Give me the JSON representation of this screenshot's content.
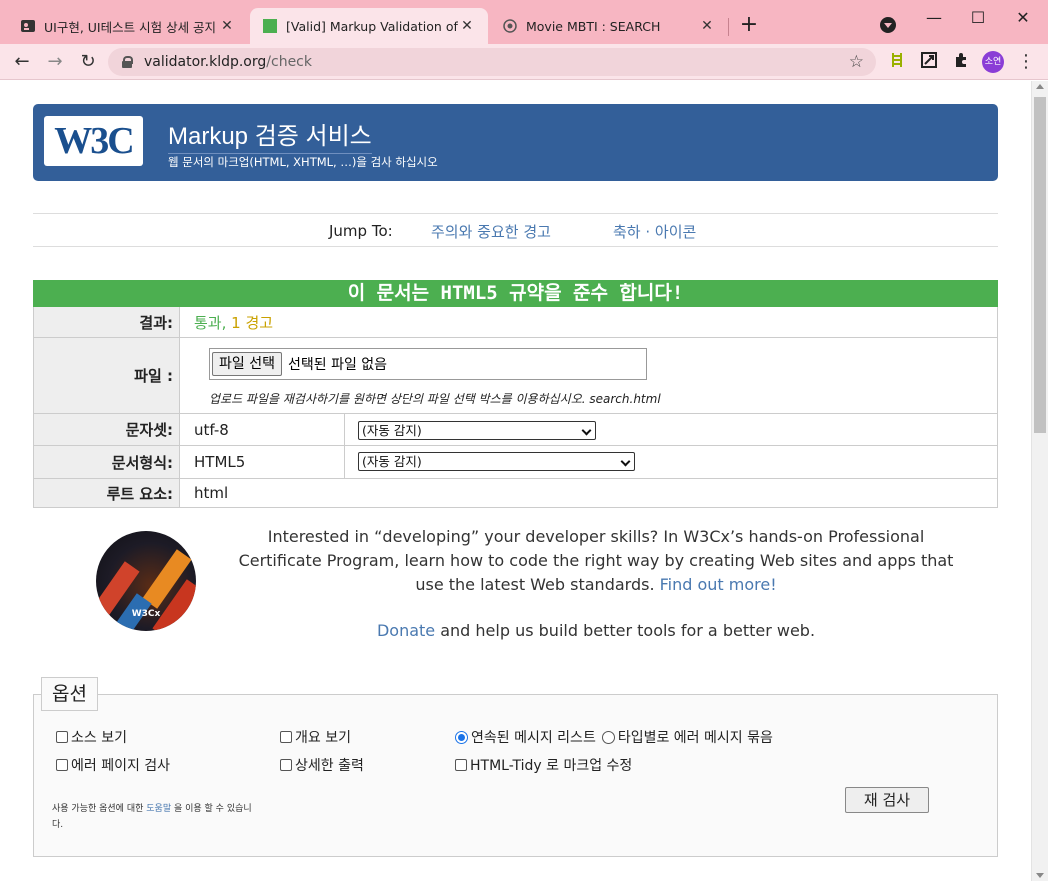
{
  "browser": {
    "tabs": [
      {
        "title": "UI구현, UI테스트 시험 상세 공지",
        "favicon": "id-card-icon"
      },
      {
        "title": "[Valid] Markup Validation of sea",
        "favicon": "green-square-icon"
      },
      {
        "title": "Movie MBTI : SEARCH",
        "favicon": "globe-icon"
      }
    ],
    "url_host": "validator.kldp.org",
    "url_path": "/check",
    "profile_label": "소연"
  },
  "banner": {
    "logo_text": "W3C",
    "title": "Markup 검증 서비스",
    "subtitle": "웹 문서의 마크업(HTML, XHTML, …)을 검사 하십시오"
  },
  "jump": {
    "label": "Jump To:",
    "links": [
      "주의와 중요한 경고",
      "축하 · 아이콘"
    ]
  },
  "result": {
    "banner": "이 문서는 HTML5 규약을 준수 합니다!",
    "rows": {
      "result_label": "결과:",
      "result_pass": "통과,",
      "result_warn": "1 경고",
      "file_label": "파일 :",
      "file_button": "파일 선택",
      "file_none": "선택된 파일 없음",
      "file_hint": "업로드 파일을 재검사하기를 원하면 상단의 파일 선택 박스를 이용하십시오. search.html",
      "charset_label": "문자셋:",
      "charset_value": "utf-8",
      "charset_select": "(자동 감지)",
      "doctype_label": "문서형식:",
      "doctype_value": "HTML5",
      "doctype_select": "(자동 감지)",
      "root_label": "루트 요소:",
      "root_value": "html"
    }
  },
  "promo": {
    "text_before": "Interested in “developing” your developer skills? In W3Cx’s hands-on Professional Certificate Program, learn how to code the right way by creating Web sites and apps that use the latest Web standards.",
    "link": "Find out more!",
    "badge_text": "W3Cx",
    "donate_link": "Donate",
    "donate_text": "and help us build better tools for a better web."
  },
  "options": {
    "legend": "옵션",
    "show_source": "소스 보기",
    "show_outline": "개요 보기",
    "list_messages": "연속된 메시지 리스트",
    "group_errors": "타입별로 에러 메시지 묶음",
    "error_pages": "에러 페이지 검사",
    "verbose": "상세한 출력",
    "tidy": "HTML-Tidy 로 마크업 수정",
    "help_text_1": "사용 가능한 옵션에 대한",
    "help_link": "도움말",
    "help_text_2": "을 이용 할 수 있습니다.",
    "recheck_button": "재 검사"
  }
}
